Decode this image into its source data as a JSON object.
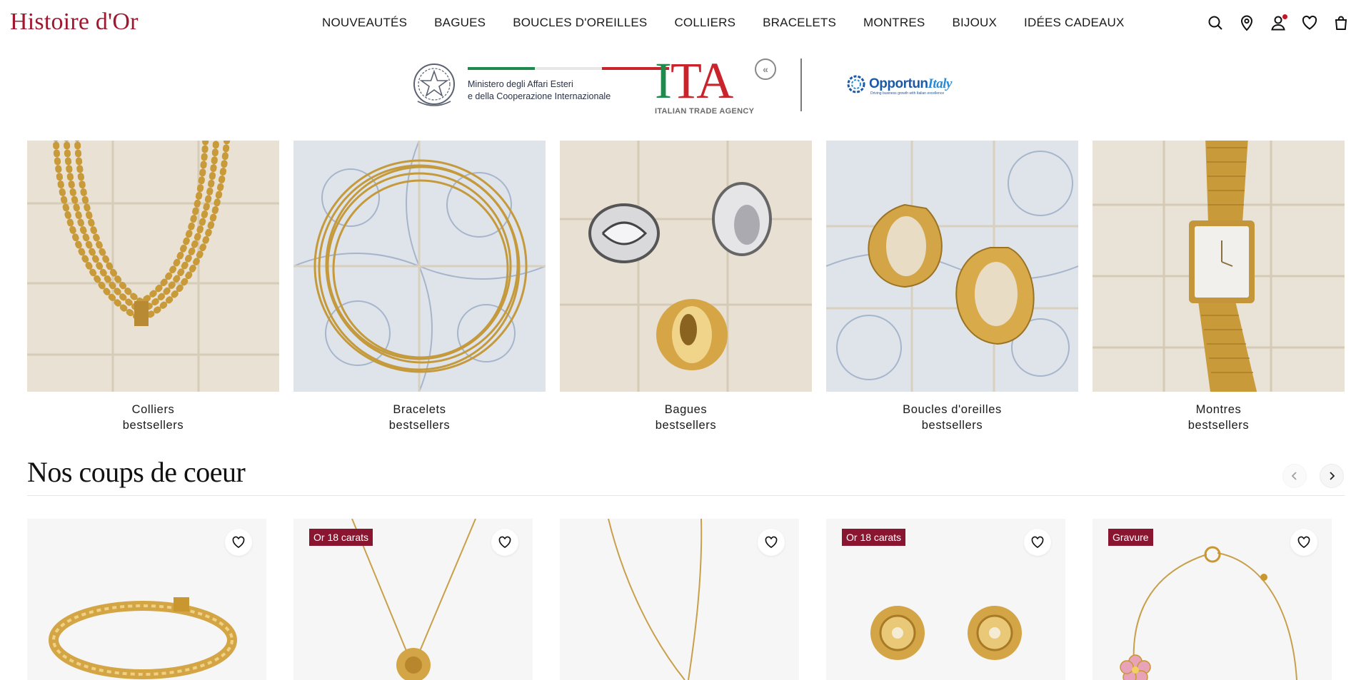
{
  "header": {
    "logo": "Histoire d'Or",
    "nav": [
      "NOUVEAUTÉS",
      "BAGUES",
      "BOUCLES D'OREILLES",
      "COLLIERS",
      "BRACELETS",
      "MONTRES",
      "BIJOUX",
      "IDÉES CADEAUX"
    ],
    "icons": [
      "search-icon",
      "store-locator-icon",
      "account-icon",
      "wishlist-icon",
      "cart-icon"
    ]
  },
  "partners": {
    "mae_line1": "Ministero degli Affari Esteri",
    "mae_line2": "e della Cooperazione Internazionale",
    "ita_logo": "ITA",
    "ita_sub": "ITALIAN TRADE AGENCY",
    "opp_main": "Opportun",
    "opp_italic": "Italy",
    "opp_tag": "Driving business growth with Italian excellence"
  },
  "categories": [
    {
      "line1": "Colliers",
      "line2": "bestsellers"
    },
    {
      "line1": "Bracelets",
      "line2": "bestsellers"
    },
    {
      "line1": "Bagues",
      "line2": "bestsellers"
    },
    {
      "line1": "Boucles d'oreilles",
      "line2": "bestsellers"
    },
    {
      "line1": "Montres",
      "line2": "bestsellers"
    }
  ],
  "section": {
    "title": "Nos coups de coeur"
  },
  "products": [
    {
      "badge": ""
    },
    {
      "badge": "Or 18 carats"
    },
    {
      "badge": ""
    },
    {
      "badge": "Or 18 carats"
    },
    {
      "badge": "Gravure"
    }
  ],
  "colors": {
    "brand": "#a0182f",
    "badge": "#8a1530",
    "gold": "#d4a94a"
  }
}
